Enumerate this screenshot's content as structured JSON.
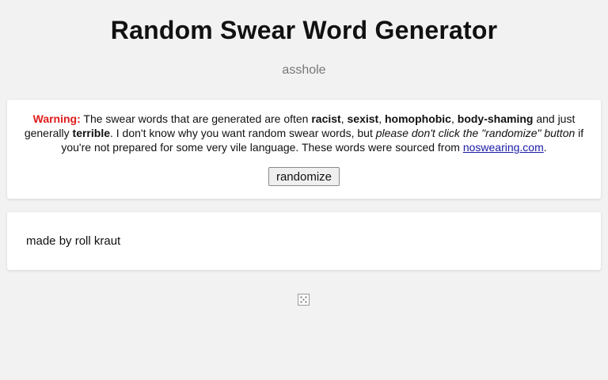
{
  "header": {
    "title": "Random Swear Word Generator",
    "current_word": "asshole"
  },
  "warning": {
    "label": "Warning:",
    "t1": " The swear words that are generated are often ",
    "b1": "racist",
    "t2": ", ",
    "b2": "sexist",
    "t3": ", ",
    "b3": "homophobic",
    "t4": ", ",
    "b4": "body-shaming",
    "t5": " and just generally ",
    "b5": "terrible",
    "t6": ". I don't know why you want random swear words, but ",
    "i1": "please don't click the \"randomize\" button",
    "t7": " if you're not prepared for some very vile language. These words were sourced from ",
    "link": "noswearing.com",
    "t8": "."
  },
  "actions": {
    "randomize_label": "randomize"
  },
  "footer": {
    "credit": "made by roll kraut"
  },
  "icons": {
    "dice": "dice-icon",
    "link_color": "#1a1aa6",
    "warning_color": "#e01b1b"
  }
}
